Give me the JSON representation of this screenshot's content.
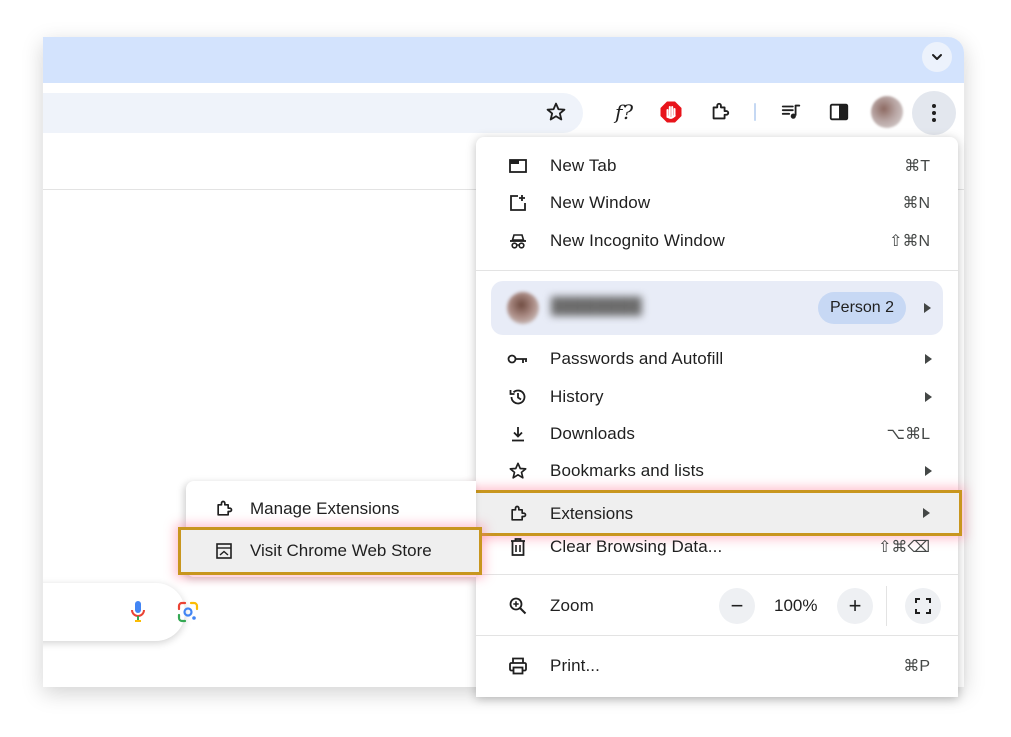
{
  "menu": {
    "new_tab": {
      "label": "New Tab",
      "shortcut": "⌘T"
    },
    "new_window": {
      "label": "New Window",
      "shortcut": "⌘N"
    },
    "new_incognito": {
      "label": "New Incognito Window",
      "shortcut": "⇧⌘N"
    },
    "profile": {
      "person": "Person 2"
    },
    "passwords": {
      "label": "Passwords and Autofill"
    },
    "history": {
      "label": "History"
    },
    "downloads": {
      "label": "Downloads",
      "shortcut": "⌥⌘L"
    },
    "bookmarks": {
      "label": "Bookmarks and lists"
    },
    "extensions": {
      "label": "Extensions"
    },
    "clear_data": {
      "label": "Clear Browsing Data...",
      "shortcut": "⇧⌘⌫"
    },
    "zoom": {
      "label": "Zoom",
      "minus": "−",
      "value": "100%",
      "plus": "+"
    },
    "print": {
      "label": "Print...",
      "shortcut": "⌘P"
    }
  },
  "submenu": {
    "manage": {
      "label": "Manage Extensions"
    },
    "visit_store": {
      "label": "Visit Chrome Web Store"
    }
  },
  "toolbar": {
    "script_icon_text": "f?"
  },
  "colors": {
    "tabstrip": "#d3e3fd",
    "highlight_border": "#c8961e",
    "chip": "#c7d8f4",
    "opera_red": "#e8141b"
  }
}
